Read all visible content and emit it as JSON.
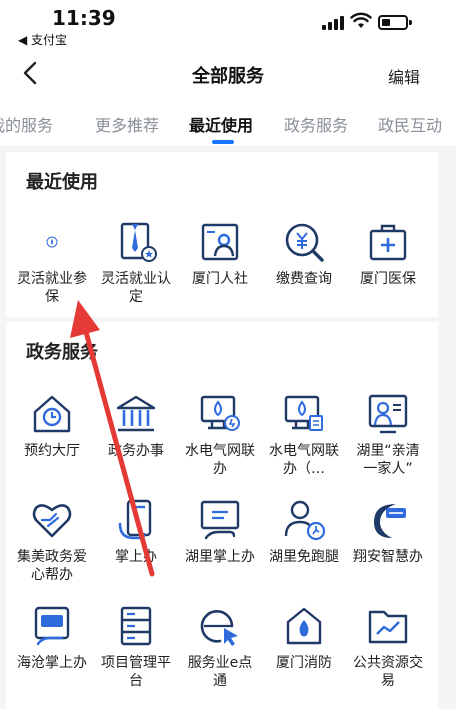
{
  "status": {
    "time": "11:39",
    "back_app": "◀ 支付宝"
  },
  "nav": {
    "title": "全部服务",
    "edit": "编辑"
  },
  "tabs": [
    {
      "label": "我的服务",
      "visible": "我的服务"
    },
    {
      "label": "更多推荐"
    },
    {
      "label": "最近使用",
      "active": true
    },
    {
      "label": "政务服务"
    },
    {
      "label": "政民互动"
    }
  ],
  "recent": {
    "title": "最近使用",
    "items": [
      {
        "label": "灵活就业参保",
        "icon": "drop-icon"
      },
      {
        "label": "灵活就业认定",
        "icon": "tie-badge-icon"
      },
      {
        "label": "厦门人社",
        "icon": "id-card-icon"
      },
      {
        "label": "缴费查询",
        "icon": "yuan-search-icon"
      },
      {
        "label": "厦门医保",
        "icon": "medkit-icon"
      }
    ]
  },
  "gov": {
    "title": "政务服务",
    "items": [
      {
        "label": "预约大厅",
        "icon": "house-clock-icon"
      },
      {
        "label": "政务办事",
        "icon": "government-building-icon"
      },
      {
        "label": "水电气网联办",
        "icon": "utility-monitor-icon"
      },
      {
        "label": "水电气网联办（…",
        "icon": "utility-monitor-icon"
      },
      {
        "label": "湖里“亲清一家人”",
        "icon": "presenter-board-icon"
      },
      {
        "label": "集美政务爱心帮办",
        "icon": "heart-hand-icon"
      },
      {
        "label": "掌上办",
        "icon": "phone-hand-icon"
      },
      {
        "label": "湖里掌上办",
        "icon": "monitor-hand-icon"
      },
      {
        "label": "湖里免跑腿",
        "icon": "person-running-icon"
      },
      {
        "label": "翔安智慧办",
        "icon": "xiangan-logo-icon"
      },
      {
        "label": "海沧掌上办",
        "icon": "haicang-tag-icon"
      },
      {
        "label": "项目管理平台",
        "icon": "server-rack-icon"
      },
      {
        "label": "服务业e点通",
        "icon": "pointer-click-icon"
      },
      {
        "label": "厦门消防",
        "icon": "fire-station-icon"
      },
      {
        "label": "公共资源交易",
        "icon": "folder-chart-icon"
      }
    ]
  },
  "colors": {
    "accent": "#1677ff",
    "icon_dark": "#1f3a66",
    "icon_blue": "#2f6bdc",
    "arrow": "#e53935"
  }
}
